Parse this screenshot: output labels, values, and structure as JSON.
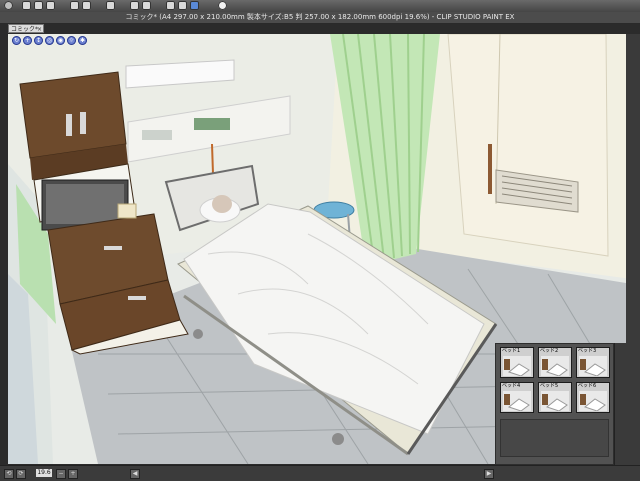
{
  "app": {
    "title": "コミック* (A4 297.00 x 210.00mm 製本サイズ:B5 判 257.00 x 182.00mm 600dpi 19.6%) - CLIP STUDIO PAINT EX",
    "tab_label": "コミック*",
    "tab_close": "×"
  },
  "status": {
    "zoom": "19.6",
    "left_btn": "◀",
    "right_btn": "▶"
  },
  "presets": {
    "items": [
      {
        "label": "ベッド1"
      },
      {
        "label": "ベッド2"
      },
      {
        "label": "ベッド3"
      },
      {
        "label": "ベッド4"
      },
      {
        "label": "ベッド5"
      },
      {
        "label": "ベッド6"
      }
    ]
  },
  "colors": {
    "curtain": "#bfe6b3",
    "wall": "#ecefe9",
    "floor": "#bcc1c4",
    "cabinet": "#6b4a2e",
    "sheet": "#f4f4f2",
    "door": "#f5f2e6"
  },
  "icons": [
    "tool-icon",
    "nav-rotate-icon",
    "nav-pan-icon",
    "nav-zoom-icon",
    "nav-reset-icon",
    "nav-camera-icon",
    "nav-light-icon"
  ]
}
